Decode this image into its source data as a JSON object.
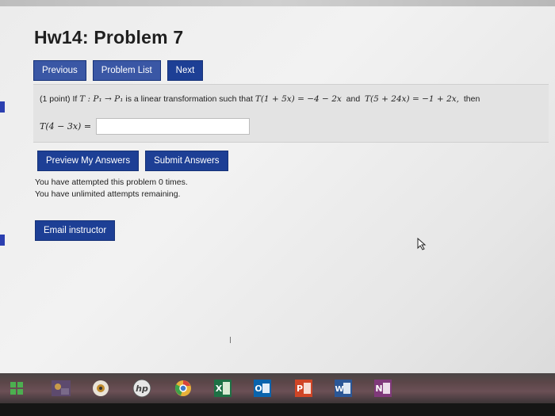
{
  "page": {
    "title": "Hw14: Problem 7"
  },
  "nav": {
    "previous": "Previous",
    "problem_list": "Problem List",
    "next": "Next"
  },
  "problem": {
    "points": "(1 point)",
    "prefix": "If",
    "math_map": "T : P₁ → P₁",
    "middle": "is a linear transformation such that",
    "cond1": "T(1 + 5x) = −4 − 2x",
    "and": "and",
    "cond2": "T(5 + 24x) = −1 + 2x,",
    "then": "then",
    "answer_label": "T(4 − 3x) =",
    "answer_value": ""
  },
  "actions": {
    "preview": "Preview My Answers",
    "submit": "Submit Answers"
  },
  "status": {
    "line1": "You have attempted this problem 0 times.",
    "line2": "You have unlimited attempts remaining."
  },
  "email": {
    "label": "Email instructor"
  },
  "taskbar": {
    "icons": [
      {
        "name": "windows-start-icon",
        "color": "#2e9e4b"
      },
      {
        "name": "photo-app-icon",
        "color": "#6a4f7a"
      },
      {
        "name": "media-player-icon",
        "color": "#e9e3d8"
      },
      {
        "name": "hp-icon",
        "color": "#e6e6e6",
        "text": "hp"
      },
      {
        "name": "chrome-icon",
        "color": "#e8b13a"
      },
      {
        "name": "excel-icon",
        "color": "#1e7145",
        "text": "X"
      },
      {
        "name": "outlook-icon",
        "color": "#0a64ad",
        "text": "O"
      },
      {
        "name": "powerpoint-icon",
        "color": "#d04526",
        "text": "P"
      },
      {
        "name": "word-icon",
        "color": "#2b5797",
        "text": "W"
      },
      {
        "name": "onenote-icon",
        "color": "#80397b",
        "text": "N"
      }
    ]
  }
}
